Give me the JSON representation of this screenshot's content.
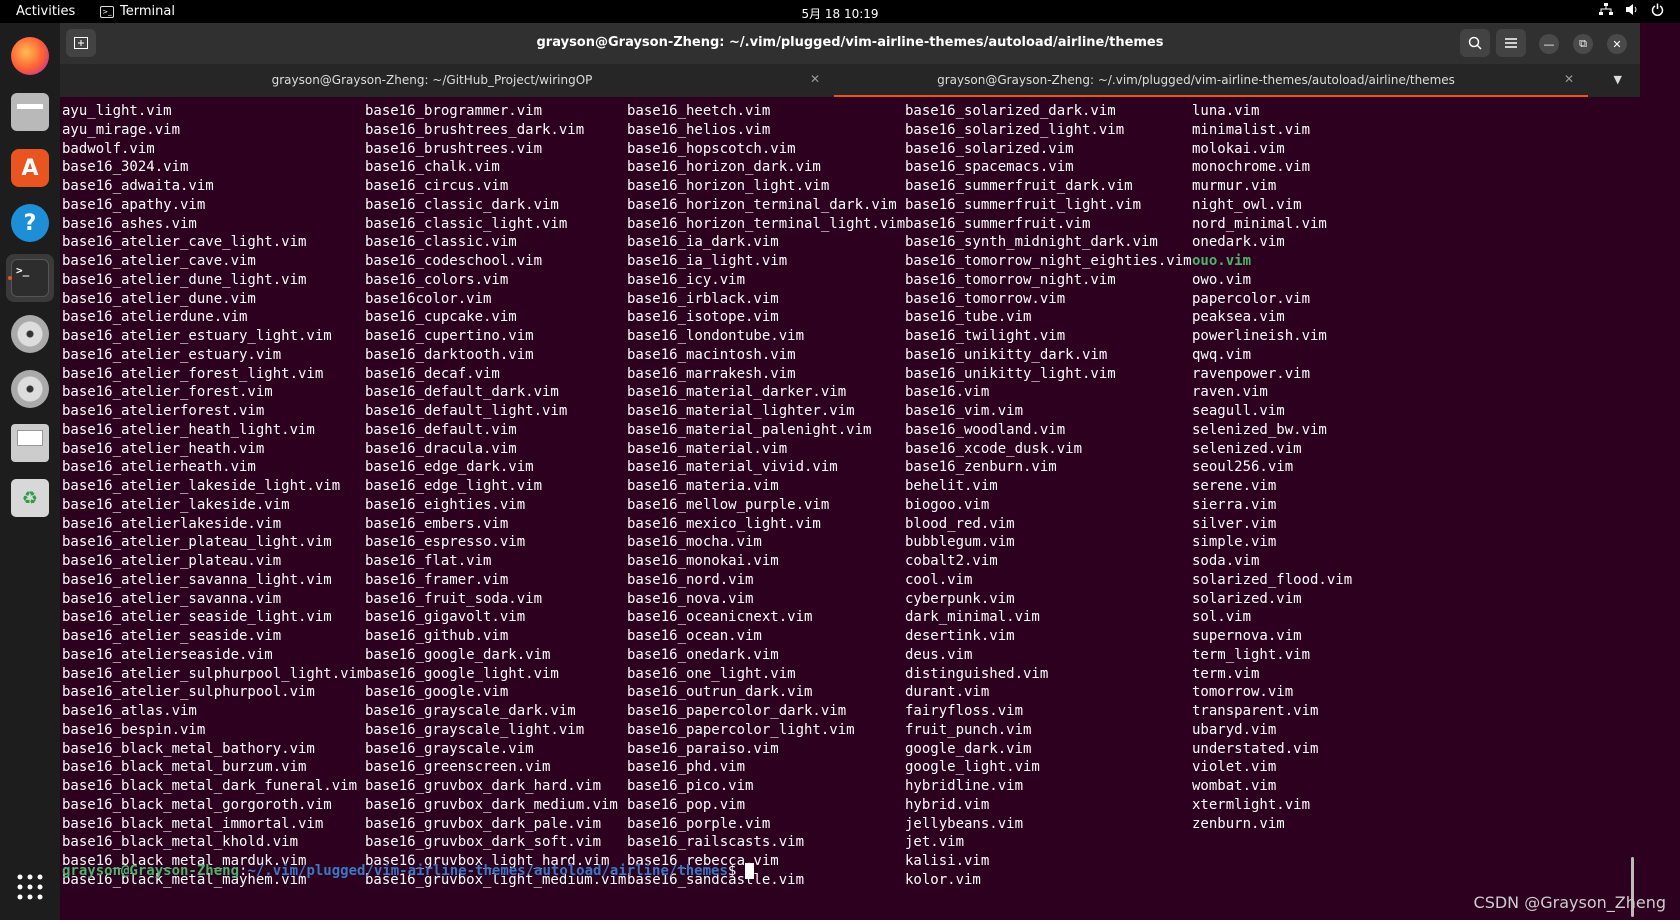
{
  "topbar": {
    "activities": "Activities",
    "app_name": "Terminal",
    "clock": "5月 18  10:19",
    "tray_icons": [
      "network-icon",
      "volume-icon",
      "power-icon"
    ]
  },
  "dock": {
    "items": [
      "firefox-icon",
      "files-icon",
      "app-center-icon",
      "help-icon",
      "terminal-icon",
      "disc-icon",
      "disc-icon",
      "floppy-icon",
      "trash-icon",
      "app-grid-icon"
    ],
    "accent": "#e95420"
  },
  "window": {
    "title": "grayson@Grayson-Zheng: ~/.vim/plugged/vim-airline-themes/autoload/airline/themes",
    "tabs": [
      {
        "label": "grayson@Grayson-Zheng: ~/GitHub_Project/wiringOP",
        "active": false
      },
      {
        "label": "grayson@Grayson-Zheng: ~/.vim/plugged/vim-airline-themes/autoload/airline/themes",
        "active": true
      }
    ]
  },
  "terminal": {
    "columns": [
      [
        "ayu_light.vim",
        "ayu_mirage.vim",
        "badwolf.vim",
        "base16_3024.vim",
        "base16_adwaita.vim",
        "base16_apathy.vim",
        "base16_ashes.vim",
        "base16_atelier_cave_light.vim",
        "base16_atelier_cave.vim",
        "base16_atelier_dune_light.vim",
        "base16_atelier_dune.vim",
        "base16_atelierdune.vim",
        "base16_atelier_estuary_light.vim",
        "base16_atelier_estuary.vim",
        "base16_atelier_forest_light.vim",
        "base16_atelier_forest.vim",
        "base16_atelierforest.vim",
        "base16_atelier_heath_light.vim",
        "base16_atelier_heath.vim",
        "base16_atelierheath.vim",
        "base16_atelier_lakeside_light.vim",
        "base16_atelier_lakeside.vim",
        "base16_atelierlakeside.vim",
        "base16_atelier_plateau_light.vim",
        "base16_atelier_plateau.vim",
        "base16_atelier_savanna_light.vim",
        "base16_atelier_savanna.vim",
        "base16_atelier_seaside_light.vim",
        "base16_atelier_seaside.vim",
        "base16_atelierseaside.vim",
        "base16_atelier_sulphurpool_light.vim",
        "base16_atelier_sulphurpool.vim",
        "base16_atlas.vim",
        "base16_bespin.vim",
        "base16_black_metal_bathory.vim",
        "base16_black_metal_burzum.vim",
        "base16_black_metal_dark_funeral.vim",
        "base16_black_metal_gorgoroth.vim",
        "base16_black_metal_immortal.vim",
        "base16_black_metal_khold.vim",
        "base16_black_metal_marduk.vim",
        "base16_black_metal_mayhem.vim"
      ],
      [
        "base16_brogrammer.vim",
        "base16_brushtrees_dark.vim",
        "base16_brushtrees.vim",
        "base16_chalk.vim",
        "base16_circus.vim",
        "base16_classic_dark.vim",
        "base16_classic_light.vim",
        "base16_classic.vim",
        "base16_codeschool.vim",
        "base16_colors.vim",
        "base16color.vim",
        "base16_cupcake.vim",
        "base16_cupertino.vim",
        "base16_darktooth.vim",
        "base16_decaf.vim",
        "base16_default_dark.vim",
        "base16_default_light.vim",
        "base16_default.vim",
        "base16_dracula.vim",
        "base16_edge_dark.vim",
        "base16_edge_light.vim",
        "base16_eighties.vim",
        "base16_embers.vim",
        "base16_espresso.vim",
        "base16_flat.vim",
        "base16_framer.vim",
        "base16_fruit_soda.vim",
        "base16_gigavolt.vim",
        "base16_github.vim",
        "base16_google_dark.vim",
        "base16_google_light.vim",
        "base16_google.vim",
        "base16_grayscale_dark.vim",
        "base16_grayscale_light.vim",
        "base16_grayscale.vim",
        "base16_greenscreen.vim",
        "base16_gruvbox_dark_hard.vim",
        "base16_gruvbox_dark_medium.vim",
        "base16_gruvbox_dark_pale.vim",
        "base16_gruvbox_dark_soft.vim",
        "base16_gruvbox_light_hard.vim",
        "base16_gruvbox_light_medium.vim"
      ],
      [
        "base16_heetch.vim",
        "base16_helios.vim",
        "base16_hopscotch.vim",
        "base16_horizon_dark.vim",
        "base16_horizon_light.vim",
        "base16_horizon_terminal_dark.vim",
        "base16_horizon_terminal_light.vim",
        "base16_ia_dark.vim",
        "base16_ia_light.vim",
        "base16_icy.vim",
        "base16_irblack.vim",
        "base16_isotope.vim",
        "base16_londontube.vim",
        "base16_macintosh.vim",
        "base16_marrakesh.vim",
        "base16_material_darker.vim",
        "base16_material_lighter.vim",
        "base16_material_palenight.vim",
        "base16_material.vim",
        "base16_material_vivid.vim",
        "base16_materia.vim",
        "base16_mellow_purple.vim",
        "base16_mexico_light.vim",
        "base16_mocha.vim",
        "base16_monokai.vim",
        "base16_nord.vim",
        "base16_nova.vim",
        "base16_oceanicnext.vim",
        "base16_ocean.vim",
        "base16_onedark.vim",
        "base16_one_light.vim",
        "base16_outrun_dark.vim",
        "base16_papercolor_dark.vim",
        "base16_papercolor_light.vim",
        "base16_paraiso.vim",
        "base16_phd.vim",
        "base16_pico.vim",
        "base16_pop.vim",
        "base16_porple.vim",
        "base16_railscasts.vim",
        "base16_rebecca.vim",
        "base16_sandcastle.vim"
      ],
      [
        "base16_solarized_dark.vim",
        "base16_solarized_light.vim",
        "base16_solarized.vim",
        "base16_spacemacs.vim",
        "base16_summerfruit_dark.vim",
        "base16_summerfruit_light.vim",
        "base16_summerfruit.vim",
        "base16_synth_midnight_dark.vim",
        "base16_tomorrow_night_eighties.vim",
        "base16_tomorrow_night.vim",
        "base16_tomorrow.vim",
        "base16_tube.vim",
        "base16_twilight.vim",
        "base16_unikitty_dark.vim",
        "base16_unikitty_light.vim",
        "base16.vim",
        "base16_vim.vim",
        "base16_woodland.vim",
        "base16_xcode_dusk.vim",
        "base16_zenburn.vim",
        "behelit.vim",
        "biogoo.vim",
        "blood_red.vim",
        "bubblegum.vim",
        "cobalt2.vim",
        "cool.vim",
        "cyberpunk.vim",
        "dark_minimal.vim",
        "desertink.vim",
        "deus.vim",
        "distinguished.vim",
        "durant.vim",
        "fairyfloss.vim",
        "fruit_punch.vim",
        "google_dark.vim",
        "google_light.vim",
        "hybridline.vim",
        "hybrid.vim",
        "jellybeans.vim",
        "jet.vim",
        "kalisi.vim",
        "kolor.vim"
      ],
      [
        "luna.vim",
        "minimalist.vim",
        "molokai.vim",
        "monochrome.vim",
        "murmur.vim",
        "night_owl.vim",
        "nord_minimal.vim",
        "onedark.vim",
        "ouo.vim",
        "owo.vim",
        "papercolor.vim",
        "peaksea.vim",
        "powerlineish.vim",
        "qwq.vim",
        "ravenpower.vim",
        "raven.vim",
        "seagull.vim",
        "selenized_bw.vim",
        "selenized.vim",
        "seoul256.vim",
        "serene.vim",
        "sierra.vim",
        "silver.vim",
        "simple.vim",
        "soda.vim",
        "solarized_flood.vim",
        "solarized.vim",
        "sol.vim",
        "supernova.vim",
        "term_light.vim",
        "term.vim",
        "tomorrow.vim",
        "transparent.vim",
        "ubaryd.vim",
        "understated.vim",
        "violet.vim",
        "wombat.vim",
        "xtermlight.vim",
        "zenburn.vim"
      ]
    ],
    "highlighted": "ouo.vim",
    "prompt": {
      "user_host": "grayson@Grayson-Zheng",
      "sep": ":",
      "path": "~/.vim/plugged/vim-airline-themes/autoload/airline/themes",
      "symbol": "$ "
    }
  },
  "watermark": "CSDN @Grayson_Zheng",
  "colors": {
    "background": "#2c001e",
    "prompt_user": "#4db36a",
    "prompt_path": "#3b78c4",
    "accent": "#e95420"
  }
}
